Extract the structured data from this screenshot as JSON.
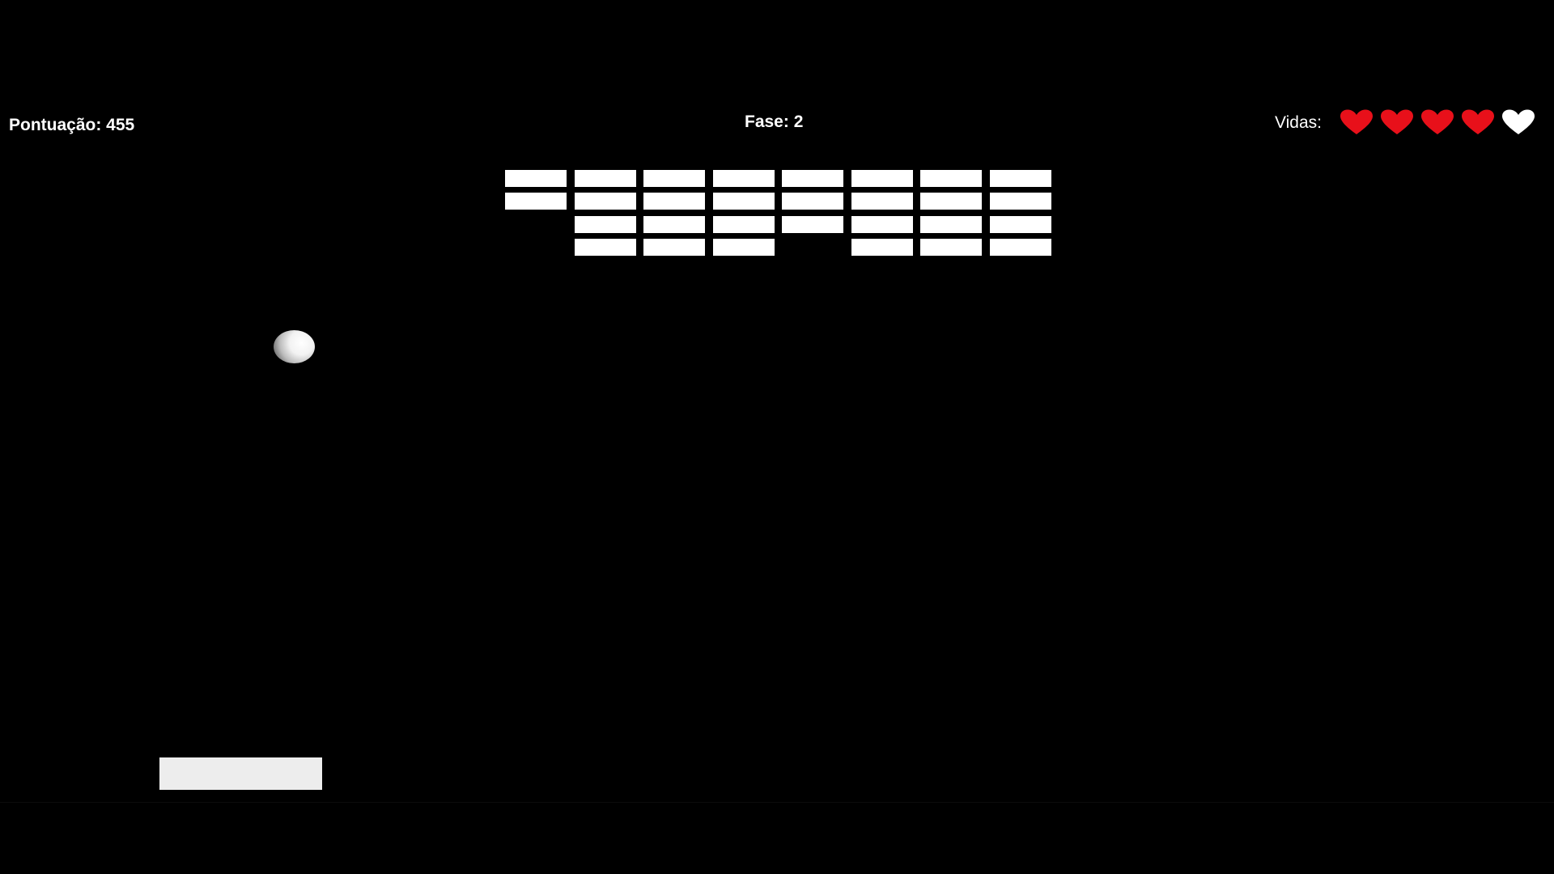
{
  "hud": {
    "score_text": "Pontuação: 455",
    "level_text": "Fase: 2",
    "lives_label": "Vidas:"
  },
  "lives": {
    "total": 5,
    "remaining": 4,
    "icon": "heart-icon",
    "full_color": "#e8101a",
    "lost_color": "#ffffff"
  },
  "bricks": {
    "color": "#ffffff",
    "columns": 8,
    "rows": 4,
    "present": [
      [
        1,
        1,
        1,
        1,
        1,
        1,
        1,
        1
      ],
      [
        1,
        1,
        1,
        1,
        1,
        1,
        1,
        1
      ],
      [
        0,
        1,
        1,
        1,
        1,
        1,
        1,
        1
      ],
      [
        0,
        1,
        1,
        1,
        0,
        1,
        1,
        1
      ]
    ]
  },
  "colors": {
    "background": "#000000",
    "text": "#ffffff",
    "paddle": "#ededed",
    "ball": "#f2f2f2"
  }
}
